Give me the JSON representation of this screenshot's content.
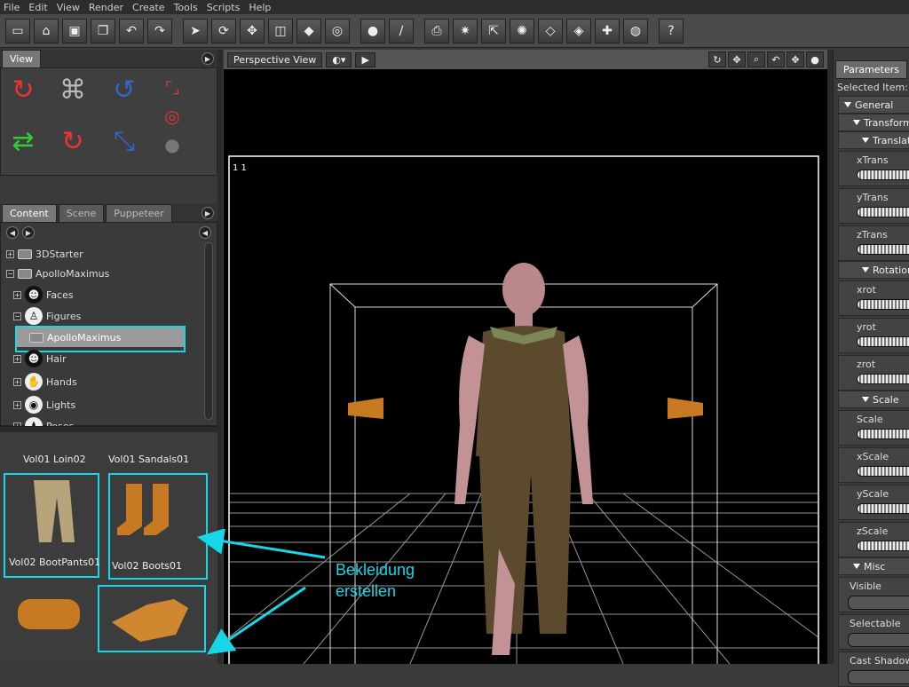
{
  "menu": [
    "File",
    "Edit",
    "View",
    "Render",
    "Create",
    "Tools",
    "Scripts",
    "Help"
  ],
  "toolbar": {
    "icons": [
      "new-file-icon",
      "open-folder-icon",
      "save-icon",
      "copy-icon",
      "undo-icon",
      "redo-icon",
      "pointer-icon",
      "rotate-icon",
      "move-icon",
      "scale-icon",
      "select-object-icon",
      "surface-icon",
      "sphere-icon",
      "bone-icon",
      "add-camera-icon",
      "add-light-icon",
      "add-spot-icon",
      "add-point-light-icon",
      "add-object-icon",
      "add-figure-icon",
      "add-prop-icon",
      "world-icon",
      "help-icon"
    ]
  },
  "view_panel": {
    "tab": "View"
  },
  "content_panel": {
    "tabs": [
      "Content",
      "Scene",
      "Puppeteer"
    ],
    "tree": [
      {
        "label": "3DStarter",
        "icon": "folder-icon",
        "indent": 0
      },
      {
        "label": "ApolloMaximus",
        "icon": "folder-icon",
        "indent": 0
      },
      {
        "label": "Faces",
        "icon": "face-icon",
        "indent": 1
      },
      {
        "label": "Figures",
        "icon": "figure-icon",
        "indent": 1
      },
      {
        "label": "ApolloMaximus",
        "icon": "folder-icon",
        "indent": 2,
        "selected": true
      },
      {
        "label": "Hair",
        "icon": "hair-icon",
        "indent": 1
      },
      {
        "label": "Hands",
        "icon": "hand-icon",
        "indent": 1
      },
      {
        "label": "Lights",
        "icon": "light-icon",
        "indent": 1
      },
      {
        "label": "Poses",
        "icon": "pose-icon",
        "indent": 1
      }
    ],
    "thumbnails": [
      {
        "label": "Vol01 Loin02"
      },
      {
        "label": "Vol01 Sandals01"
      },
      {
        "label": "Vol02 BootPants01"
      },
      {
        "label": "Vol02 Boots01"
      }
    ],
    "annotation": {
      "line1": "Bekleidung",
      "line2": "erstellen"
    }
  },
  "viewport": {
    "camera_label": "Perspective View",
    "frame_label": "1  1",
    "tool_icons": [
      "trackball-icon",
      "move-xz-icon",
      "zoom-icon",
      "rotate-view-icon",
      "move-xy-icon",
      "pin-icon"
    ]
  },
  "parameters": {
    "tab": "Parameters",
    "selected_item": "Selected Item: Vo",
    "sections": [
      {
        "kind": "section",
        "label": "General",
        "level": 0
      },
      {
        "kind": "section",
        "label": "Transform",
        "level": 1
      },
      {
        "kind": "section",
        "label": "Translat",
        "level": 2
      },
      {
        "kind": "dial",
        "label": "xTrans"
      },
      {
        "kind": "dial",
        "label": "yTrans"
      },
      {
        "kind": "dial",
        "label": "zTrans"
      },
      {
        "kind": "section",
        "label": "Rotation",
        "level": 2
      },
      {
        "kind": "dial",
        "label": "xrot"
      },
      {
        "kind": "dial",
        "label": "yrot"
      },
      {
        "kind": "dial",
        "label": "zrot"
      },
      {
        "kind": "section",
        "label": "Scale",
        "level": 2
      },
      {
        "kind": "dial",
        "label": "Scale"
      },
      {
        "kind": "dial",
        "label": "xScale"
      },
      {
        "kind": "dial",
        "label": "yScale"
      },
      {
        "kind": "dial",
        "label": "zScale"
      },
      {
        "kind": "section",
        "label": "Misc",
        "level": 1
      },
      {
        "kind": "toggle",
        "label": "Visible"
      },
      {
        "kind": "toggle",
        "label": "Selectable"
      },
      {
        "kind": "toggle",
        "label": "Cast Shadows"
      }
    ]
  },
  "colors": {
    "highlight": "#19d6e6"
  }
}
